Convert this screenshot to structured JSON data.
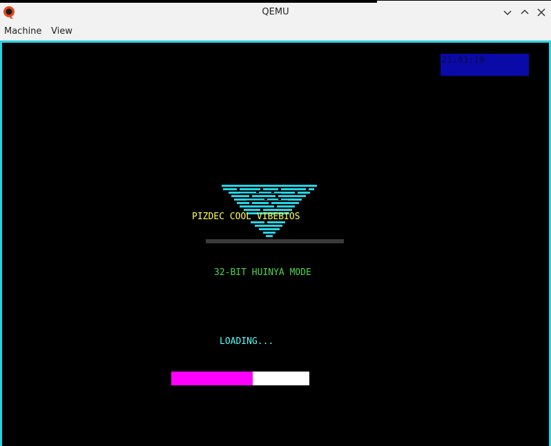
{
  "window": {
    "title": "QEMU",
    "icon": "qemu-logo-icon",
    "controls": [
      "chevron-down-icon",
      "chevron-up-icon",
      "close-icon"
    ]
  },
  "menu": {
    "items": [
      {
        "label": "Machine"
      },
      {
        "label": "View"
      }
    ]
  },
  "guest": {
    "clock": "21:03:19",
    "bios_title": "PIZDEC COOL VIBEBIOS",
    "mode": "32-BIT HUINYA MODE",
    "loading": "LOADING...",
    "progress_fraction": 0.59,
    "colors": {
      "border": "#23d5e6",
      "clock_bg": "#0a0aa8",
      "title": "#ffff55",
      "mode": "#4cd94c",
      "loading": "#55ffff",
      "progress_fill": "#ff00ff",
      "progress_track": "#ffffff",
      "logo": "#23d5e6"
    }
  }
}
